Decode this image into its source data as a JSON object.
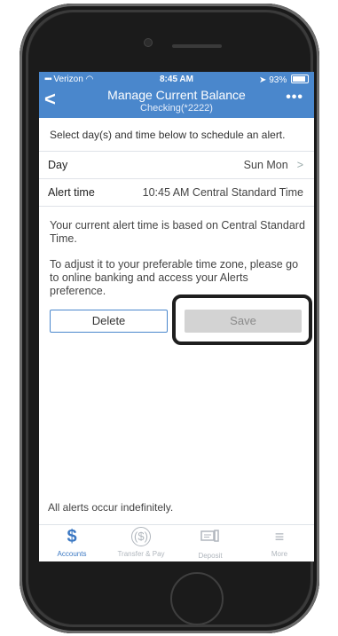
{
  "status_bar": {
    "carrier": "Verizon",
    "time": "8:45 AM",
    "battery": "93%"
  },
  "header": {
    "back": "<",
    "title": "Manage Current Balance",
    "subtitle": "Checking(*2222)",
    "more": "•••"
  },
  "hint": "Select day(s) and time below to schedule an alert.",
  "rows": [
    {
      "label": "Day",
      "value": "Sun Mon",
      "chevron": ">"
    },
    {
      "label": "Alert time",
      "value": "10:45 AM Central Standard Time"
    }
  ],
  "info": {
    "p1": "Your current alert time is based on Central Standard Time.",
    "p2": "To adjust it to your preferable time zone, please go to online banking and access your Alerts preference."
  },
  "buttons": {
    "delete": "Delete",
    "save": "Save"
  },
  "footer_note": "All alerts occur indefinitely.",
  "tabs": [
    {
      "label": "Accounts",
      "icon": "$",
      "active": true
    },
    {
      "label": "Transfer & Pay",
      "icon": "($)",
      "active": false
    },
    {
      "label": "Deposit",
      "icon": "deposit-icon",
      "active": false
    },
    {
      "label": "More",
      "icon": "≡",
      "active": false
    }
  ],
  "colors": {
    "header": "#4a87cc",
    "accent": "#3b78c3",
    "save_disabled": "#d3d3d3"
  }
}
